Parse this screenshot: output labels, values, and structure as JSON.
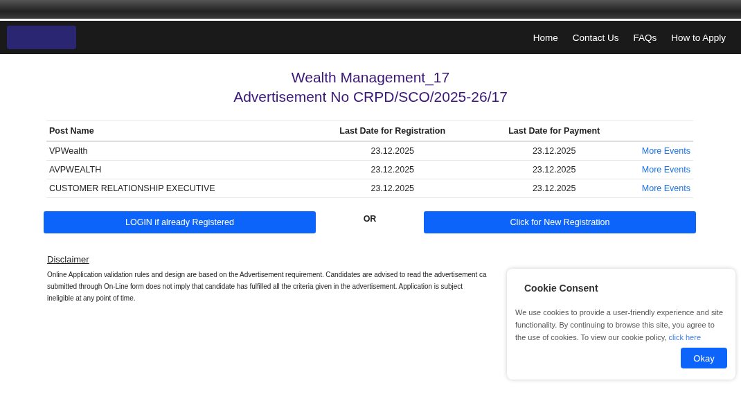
{
  "nav": [
    "Home",
    "Contact Us",
    "FAQs",
    "How to Apply"
  ],
  "title": "Wealth Management_17",
  "subtitle": "Advertisement No CRPD/SCO/2025-26/17",
  "table": {
    "columns": [
      "Post Name",
      "Last Date for Registration",
      "Last Date for Payment"
    ],
    "rows": [
      {
        "post": "VPWealth",
        "registration": "23.12.2025",
        "payment": "23.12.2025",
        "link": "More Events"
      },
      {
        "post": "AVPWEALTH",
        "registration": "23.12.2025",
        "payment": "23.12.2025",
        "link": "More Events"
      },
      {
        "post": "CUSTOMER RELATIONSHIP EXECUTIVE",
        "registration": "23.12.2025",
        "payment": "23.12.2025",
        "link": "More Events"
      }
    ]
  },
  "login_button": "LOGIN if already Registered",
  "or": "OR",
  "register_button": "Click for New Registration",
  "disclaimer": {
    "heading": "Disclaimer",
    "lines": [
      "Online Application validation rules and design are based on the Advertisement requirement. Candidates are advised to read the advertisement ca",
      "submitted through On-Line form does not imply that candidate has fulfilled all the criteria given in the advertisement. Application is subject",
      "ineligible at any point of time."
    ]
  },
  "cookie": {
    "title": "Cookie Consent",
    "text": "We use cookies to provide a user-friendly experience and site functionality. By continuing to browse this site, you agree to the use of cookies. To view our cookie policy,",
    "link": "click here",
    "button": "Okay"
  }
}
